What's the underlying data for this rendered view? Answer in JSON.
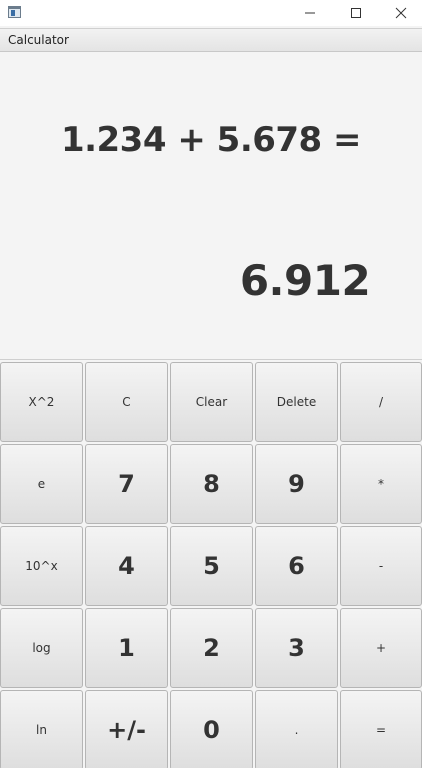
{
  "window": {
    "app_icon": "calculator-app-icon",
    "controls": {
      "minimize_icon": "minimize-icon",
      "maximize_icon": "maximize-icon",
      "close_icon": "close-icon"
    }
  },
  "menubar": {
    "items": [
      "Calculator"
    ]
  },
  "display": {
    "expression": "1.234 + 5.678 =",
    "result": "6.912"
  },
  "keypad": {
    "rows": [
      [
        "X^2",
        "C",
        "Clear",
        "Delete",
        "/"
      ],
      [
        "e",
        "7",
        "8",
        "9",
        "*"
      ],
      [
        "10^x",
        "4",
        "5",
        "6",
        "-"
      ],
      [
        "log",
        "1",
        "2",
        "3",
        "+"
      ],
      [
        "ln",
        "+/-",
        "0",
        ".",
        "="
      ]
    ]
  }
}
